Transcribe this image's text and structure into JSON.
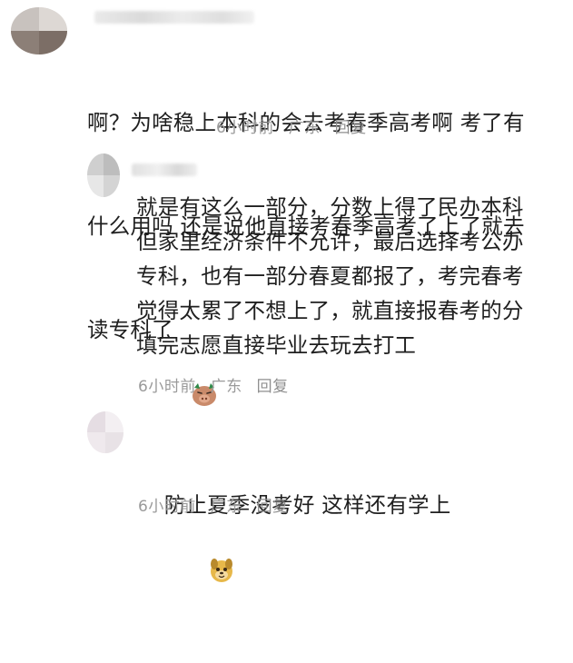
{
  "comments": [
    {
      "text_line1": "啊？为啥稳上本科的会去考春季高考啊 考了有",
      "text_line2": "什么用吗 还是说他直接考春季高考了上了就去",
      "text_line3": "读专科了",
      "emoji": "pig-face-emoji",
      "time": "6小时前",
      "location": "广东",
      "reply_label": "回复"
    },
    {
      "text": "就是有这么一部分，分数上得了民办本科\n但家里经济条件不允许，最后选择考公办\n专科，也有一部分春夏都报了，考完春考\n觉得太累了不想上了，就直接报春考的分\n填完志愿直接毕业去玩去打工",
      "time": "6小时前",
      "location": "广东",
      "reply_label": "回复"
    },
    {
      "text": "防止夏季没考好 这样还有学上",
      "emoji": "dog-face-emoji",
      "time": "6小时前",
      "location": "广东",
      "reply_label": "回复"
    }
  ],
  "colors": {
    "text": "#1f1f1f",
    "meta": "#9a9a9a"
  }
}
